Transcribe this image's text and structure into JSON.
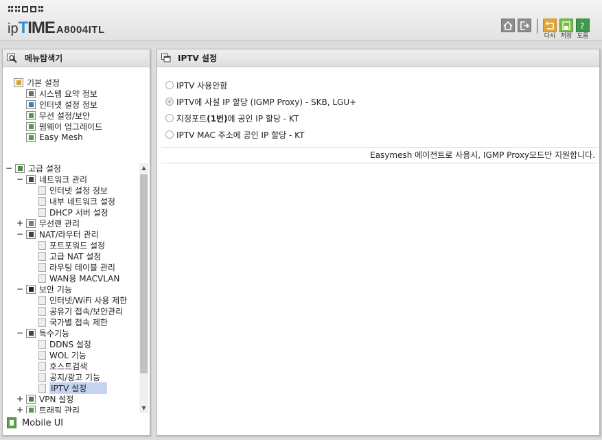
{
  "header": {
    "logo_prefix": "ip",
    "logo_t": "T",
    "logo_ime": "IME",
    "model": "A8004ITL",
    "buttons": [
      {
        "icon": "home-icon",
        "label": ""
      },
      {
        "icon": "logout-icon",
        "label": ""
      },
      {
        "icon": "undo-icon",
        "label": "다시"
      },
      {
        "icon": "save-icon",
        "label": "저장"
      },
      {
        "icon": "help-icon",
        "label": "도움"
      }
    ]
  },
  "sidebar": {
    "title": "메뉴탐색기",
    "basic_label": "기본 설정",
    "basic_items": [
      "시스템 요약 정보",
      "인터넷 설정 정보",
      "무선 설정/보안",
      "펌웨어 업그레이드",
      "Easy Mesh"
    ],
    "advanced": {
      "label": "고급 설정",
      "network": {
        "label": "네트워크 관리",
        "items": [
          "인터넷 설정 정보",
          "내부 네트워크 설정",
          "DHCP 서버 설정"
        ]
      },
      "wireless": {
        "label": "무선랜 관리"
      },
      "nat": {
        "label": "NAT/라우터 관리",
        "items": [
          "포트포워드 설정",
          "고급 NAT 설정",
          "라우팅 테이블 관리",
          "WAN용 MACVLAN"
        ]
      },
      "security": {
        "label": "보안 기능",
        "items": [
          "인터넷/WiFi 사용 제한",
          "공유기 접속/보안관리",
          "국가별 접속 제한"
        ]
      },
      "special": {
        "label": "특수기능",
        "items": [
          "DDNS 설정",
          "WOL 기능",
          "호스트검색",
          "공지/광고 기능",
          "IPTV 설정"
        ]
      },
      "vpn": {
        "label": "VPN 설정"
      },
      "traffic": {
        "label": "트래픽 관리"
      }
    },
    "mobile_label": "Mobile UI"
  },
  "main": {
    "title": "IPTV 설정",
    "options": [
      {
        "label": "IPTV 사용안함",
        "state": "unchecked"
      },
      {
        "label": "IPTV에 사설 IP 할당 (IGMP Proxy) - SKB, LGU+",
        "state": "disabled"
      },
      {
        "label_pre": "지정포트",
        "label_bold": "(1번)",
        "label_post": "에 공인 IP 할당 - KT",
        "state": "unchecked"
      },
      {
        "label": "IPTV MAC 주소에 공인 IP 할당 - KT",
        "state": "unchecked"
      }
    ],
    "note": "Easymesh 에이전트로 사용시, IGMP Proxy모드만 지원합니다."
  }
}
